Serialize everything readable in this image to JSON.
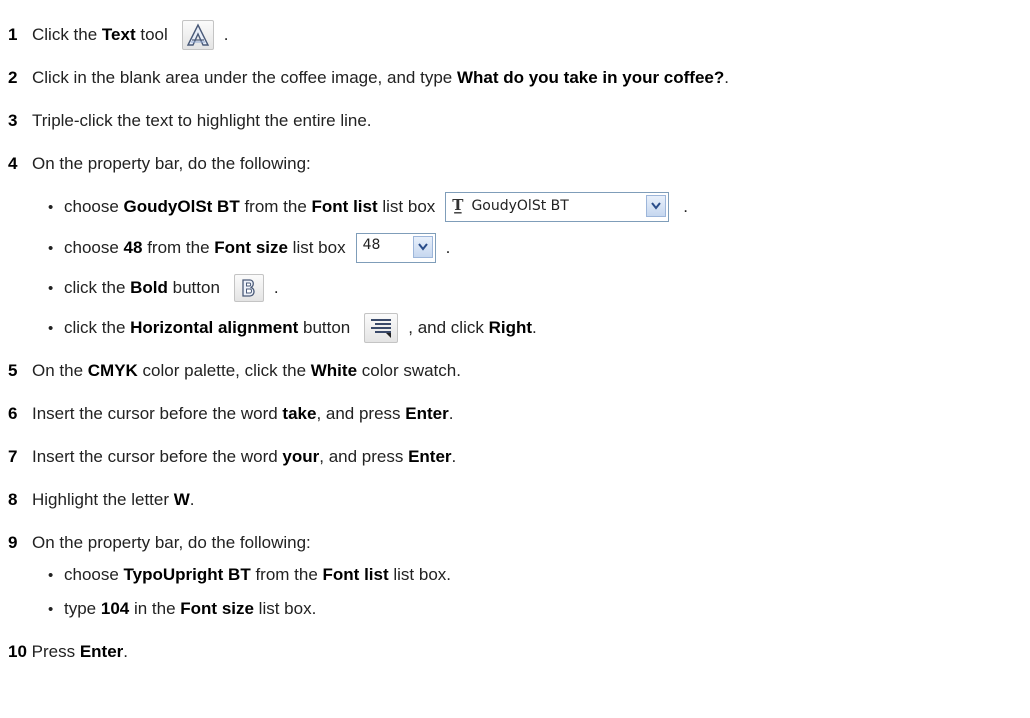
{
  "steps": {
    "s1": {
      "num": "1",
      "t1": "Click the ",
      "b1": "Text",
      "t2": " tool",
      "end": "."
    },
    "s2": {
      "num": "2",
      "t1": "Click in the blank area under the coffee image, and type ",
      "b1": "What do you take in your coffee?",
      "end": "."
    },
    "s3": {
      "num": "3",
      "t1": "Triple-click the text to highlight the entire line."
    },
    "s4": {
      "num": "4",
      "t1": "On the property bar, do the following:",
      "bullets": [
        {
          "t1": "choose ",
          "b1": "GoudyOlSt BT",
          "t2": " from the ",
          "b2": "Font list",
          "t3": " list box",
          "end": "."
        },
        {
          "t1": "choose ",
          "b1": "48",
          "t2": " from the ",
          "b2": "Font size",
          "t3": " list box",
          "end": "."
        },
        {
          "t1": "click the ",
          "b1": "Bold",
          "t2": " button",
          "end": "."
        },
        {
          "t1": "click the ",
          "b1": "Horizontal alignment",
          "t2": " button",
          "t3": ", and click ",
          "b2": "Right",
          "end": "."
        }
      ]
    },
    "s5": {
      "num": "5",
      "t1": "On the ",
      "b1": "CMYK",
      "t2": " color palette, click the ",
      "b2": "White",
      "t3": " color swatch."
    },
    "s6": {
      "num": "6",
      "t1": "Insert the cursor before the word ",
      "b1": "take",
      "t2": ", and press ",
      "b2": "Enter",
      "end": "."
    },
    "s7": {
      "num": "7",
      "t1": "Insert the cursor before the word ",
      "b1": "your",
      "t2": ", and press ",
      "b2": "Enter",
      "end": "."
    },
    "s8": {
      "num": "8",
      "t1": "Highlight the letter ",
      "b1": "W",
      "end": "."
    },
    "s9": {
      "num": "9",
      "t1": "On the property bar, do the following:",
      "bullets": [
        {
          "t1": "choose ",
          "b1": "TypoUpright BT",
          "t2": " from the ",
          "b2": "Font list",
          "t3": " list box."
        },
        {
          "t1": "type ",
          "b1": "104",
          "t2": " in the ",
          "b2": "Font size",
          "t3": " list box."
        }
      ]
    },
    "s10": {
      "num": "10",
      "t1": " Press ",
      "b1": "Enter",
      "end": "."
    }
  },
  "ui": {
    "font_list_value": "GoudyOlSt BT",
    "font_size_value": "48",
    "bullet_glyph": "•"
  },
  "icons": {
    "text_tool": "text-tool-icon",
    "font_type": "truetype-font-icon",
    "dropdown": "chevron-down-icon",
    "bold": "bold-icon",
    "align": "horizontal-alignment-icon"
  },
  "colors": {
    "accent": "#3a6fc4",
    "text": "#222222"
  }
}
